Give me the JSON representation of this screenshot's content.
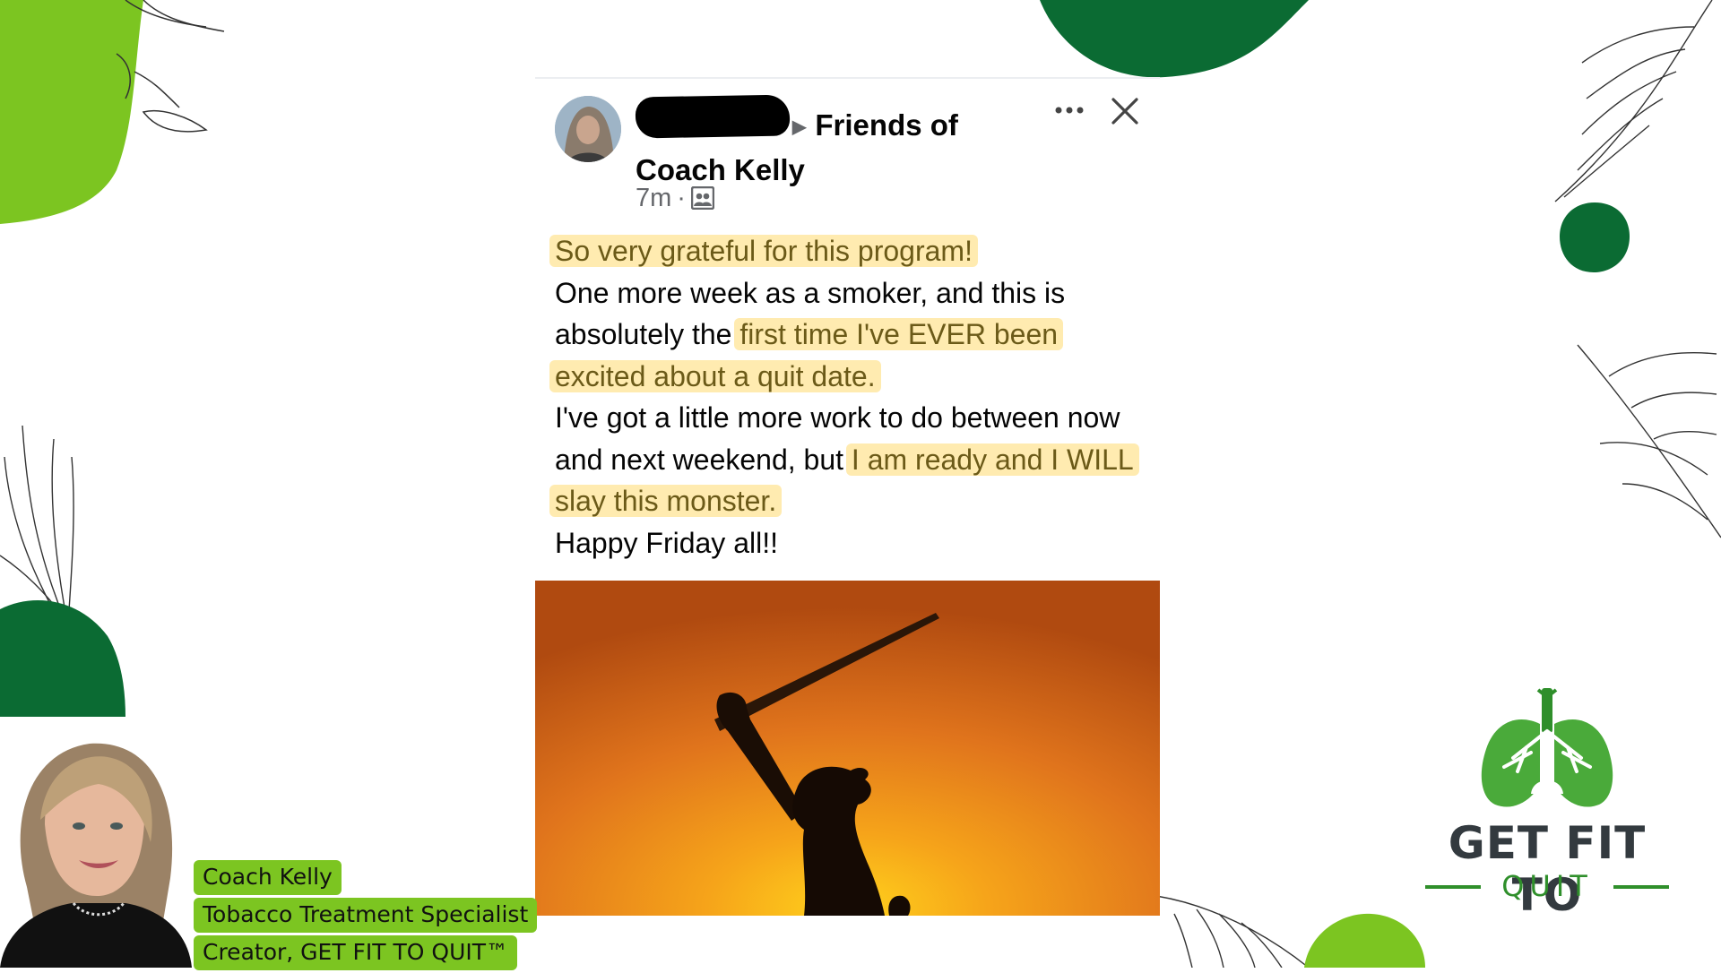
{
  "post": {
    "group_arrow": "▶",
    "group_name": "Friends of Coach Kelly",
    "time": "7m",
    "time_separator": "·",
    "audience_icon": "group-audience-icon",
    "more_icon": "more-horizontal-icon",
    "close_icon": "close-icon",
    "text": {
      "line1_highlight": "So very grateful for this program!",
      "line2": "One more week as a smoker, and this is absolutely the ",
      "line2_highlight": "first time I've EVER been excited about a quit date.",
      "line3": "I've got a little more work to do between now and next weekend, but ",
      "line3_highlight": "I am ready and I WILL slay this monster.",
      "line4": "Happy Friday all!!"
    },
    "highlight_color": "#ffd250"
  },
  "coach": {
    "name": "Coach Kelly",
    "title": "Tobacco Treatment Specialist",
    "creator": "Creator, GET FIT TO QUIT™",
    "label_color": "#7cc521"
  },
  "logo": {
    "title": "GET FIT TO",
    "subtitle": "QUIT",
    "icon": "lungs-icon",
    "brand_green": "#2f8f2b",
    "dark_green": "#0b6b33"
  }
}
